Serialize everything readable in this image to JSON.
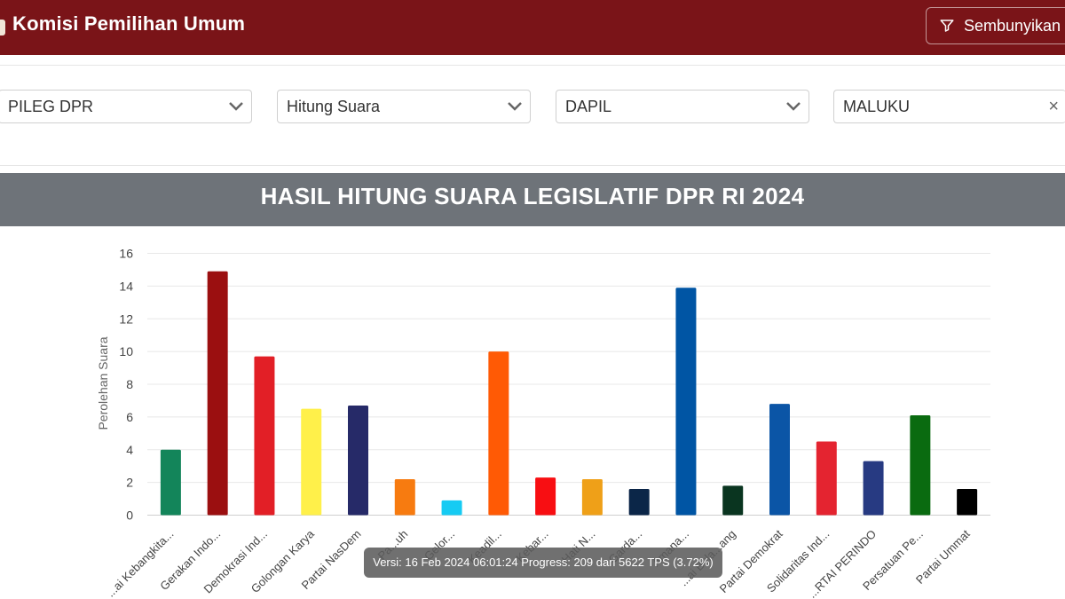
{
  "header": {
    "title": "Komisi Pemilihan Umum",
    "hide_button_label": "Sembunyikan",
    "icons": {
      "filter": "filter-icon"
    }
  },
  "filters": {
    "election_type": "PILEG DPR",
    "data_type": "Hitung Suara",
    "region_level": "DAPIL",
    "region": "MALUKU"
  },
  "chart_title": "HASIL HITUNG SUARA LEGISLATIF DPR RI 2024",
  "tooltip": "Versi: 16 Feb 2024 06:01:24 Progress: 209 dari 5622 TPS (3.72%)",
  "colors": {
    "header_bg": "#7a1418",
    "chart_header_bg": "#6e7379"
  },
  "chart_data": {
    "type": "bar",
    "ylabel": "Perolehan Suara",
    "xlabel": "",
    "ylim": [
      0,
      16
    ],
    "yticks": [
      0,
      2,
      4,
      6,
      8,
      10,
      12,
      14,
      16
    ],
    "grid": true,
    "categories": [
      "...ai Kebangkita...",
      "Gerakan Indo...",
      "Demokrasi Ind...",
      "Golongan Karya",
      "Partai NasDem",
      "Pa...uh",
      "Gelor...",
      "Keadil...",
      "Kebar...",
      "Hati N...",
      "Garda...",
      "Amana...",
      "...ai Bula...ang",
      "Partai Demokrat",
      "Solidaritas Ind...",
      "...RTAI PERINDO",
      "Persatuan Pe...",
      "Partai Ummat"
    ],
    "values": [
      4.0,
      14.9,
      9.7,
      6.5,
      6.7,
      2.2,
      0.9,
      10.0,
      2.3,
      2.2,
      1.6,
      13.9,
      1.8,
      6.8,
      4.5,
      3.3,
      6.1,
      1.6
    ],
    "colors": [
      "#13855a",
      "#9b0f10",
      "#e21f26",
      "#fff04a",
      "#262a68",
      "#f77b10",
      "#16cbf3",
      "#ff5a05",
      "#f80e12",
      "#efa018",
      "#0b2648",
      "#0055a4",
      "#0a3520",
      "#0b55a6",
      "#e42430",
      "#273a82",
      "#0a6b10",
      "#000000"
    ]
  }
}
